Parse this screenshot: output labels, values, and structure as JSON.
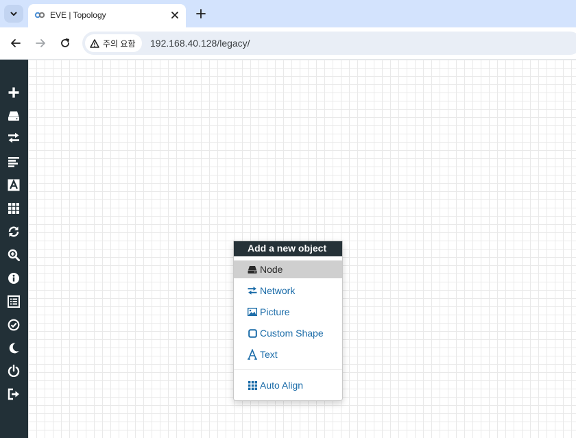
{
  "browser": {
    "tab_title": "EVE | Topology",
    "security_label": "주의 요함",
    "url": "192.168.40.128/legacy/"
  },
  "sidebar": {
    "items": [
      {
        "name": "add-object",
        "icon": "plus-icon"
      },
      {
        "name": "nodes",
        "icon": "hdd-icon"
      },
      {
        "name": "networks",
        "icon": "exchange-icon"
      },
      {
        "name": "startup-configs",
        "icon": "align-left-icon"
      },
      {
        "name": "text-objects",
        "icon": "font-icon"
      },
      {
        "name": "more-actions",
        "icon": "grid-icon"
      },
      {
        "name": "refresh",
        "icon": "refresh-icon"
      },
      {
        "name": "zoom",
        "icon": "zoom-in-icon"
      },
      {
        "name": "status",
        "icon": "info-icon"
      },
      {
        "name": "lab-details",
        "icon": "list-icon"
      },
      {
        "name": "lock-lab",
        "icon": "check-circle-icon"
      },
      {
        "name": "dark-mode",
        "icon": "moon-icon"
      },
      {
        "name": "close-lab",
        "icon": "power-icon"
      },
      {
        "name": "logout",
        "icon": "sign-out-icon"
      }
    ]
  },
  "context_menu": {
    "title": "Add a new object",
    "items": [
      {
        "label": "Node",
        "icon": "hdd-icon"
      },
      {
        "label": "Network",
        "icon": "exchange-icon"
      },
      {
        "label": "Picture",
        "icon": "picture-icon"
      },
      {
        "label": "Custom Shape",
        "icon": "square-icon"
      },
      {
        "label": "Text",
        "icon": "font-icon"
      },
      {
        "label": "Auto Align",
        "icon": "grid-icon"
      }
    ]
  },
  "colors": {
    "sidebar_bg": "#223037",
    "menu_header_bg": "#263238",
    "link_blue": "#1a6ba8",
    "active_item_bg": "#cfcfcf"
  }
}
